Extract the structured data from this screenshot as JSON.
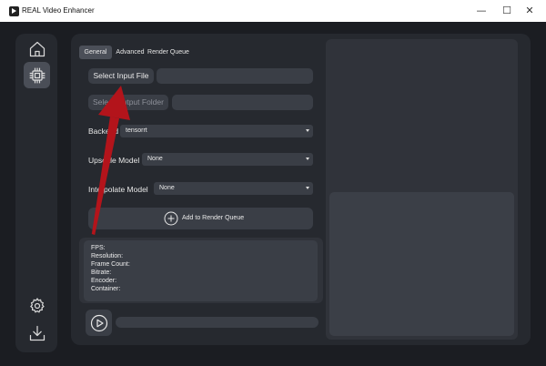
{
  "window": {
    "title": "REAL Video Enhancer",
    "controls": {
      "minimize": "—",
      "maximize": "☐",
      "close": "✕"
    }
  },
  "sidebar": {
    "items": [
      {
        "icon": "home-icon",
        "active": false
      },
      {
        "icon": "processor-icon",
        "active": true
      },
      {
        "icon": "gear-icon",
        "active": false
      },
      {
        "icon": "download-icon",
        "active": false
      }
    ]
  },
  "tabs": [
    {
      "label": "General",
      "active": true
    },
    {
      "label": "Advanced",
      "active": false
    },
    {
      "label": "Render Queue",
      "active": false
    }
  ],
  "general": {
    "select_input_label": "Select Input File",
    "input_path": "",
    "select_output_label": "Select Output Folder",
    "output_path": "",
    "backend": {
      "label": "Backend",
      "value": "tensorrt"
    },
    "upscale_model": {
      "label": "Upscale Model",
      "value": "None"
    },
    "interpolate_model": {
      "label": "Interpolate Model",
      "value": "None"
    },
    "add_to_queue_label": "Add to Render Queue"
  },
  "video_info": {
    "fps": "FPS:",
    "resolution": "Resolution:",
    "frame_count": "Frame Count:",
    "bitrate": "Bitrate:",
    "encoder": "Encoder:",
    "container": "Container:"
  },
  "render": {
    "progress": 0
  },
  "colors": {
    "background": "#1b1d22",
    "panel": "#26292f",
    "control": "#3a3e46",
    "active_tab": "#4b4f58",
    "annotation_arrow": "#b3141b"
  }
}
